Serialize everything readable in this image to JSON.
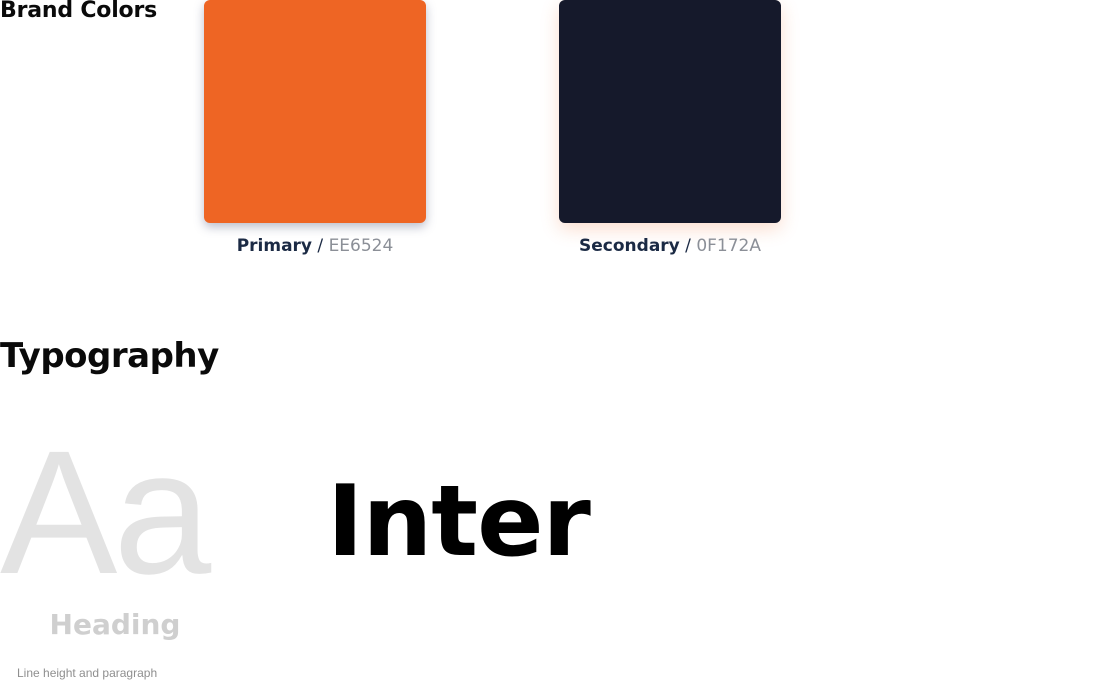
{
  "brand_colors": {
    "title": "Brand Colors",
    "swatches": [
      {
        "name": "Primary",
        "separator": "/",
        "hex": "EE6524",
        "color": "#EE6524"
      },
      {
        "name": "Secondary",
        "separator": "/",
        "hex": "0F172A",
        "color": "#15192B"
      }
    ]
  },
  "typography": {
    "title": "Typography",
    "sample_glyphs": "Aa",
    "sample_caption": "Heading",
    "sample_subcaption": "Line height and paragraph",
    "font_name": "Inter"
  }
}
